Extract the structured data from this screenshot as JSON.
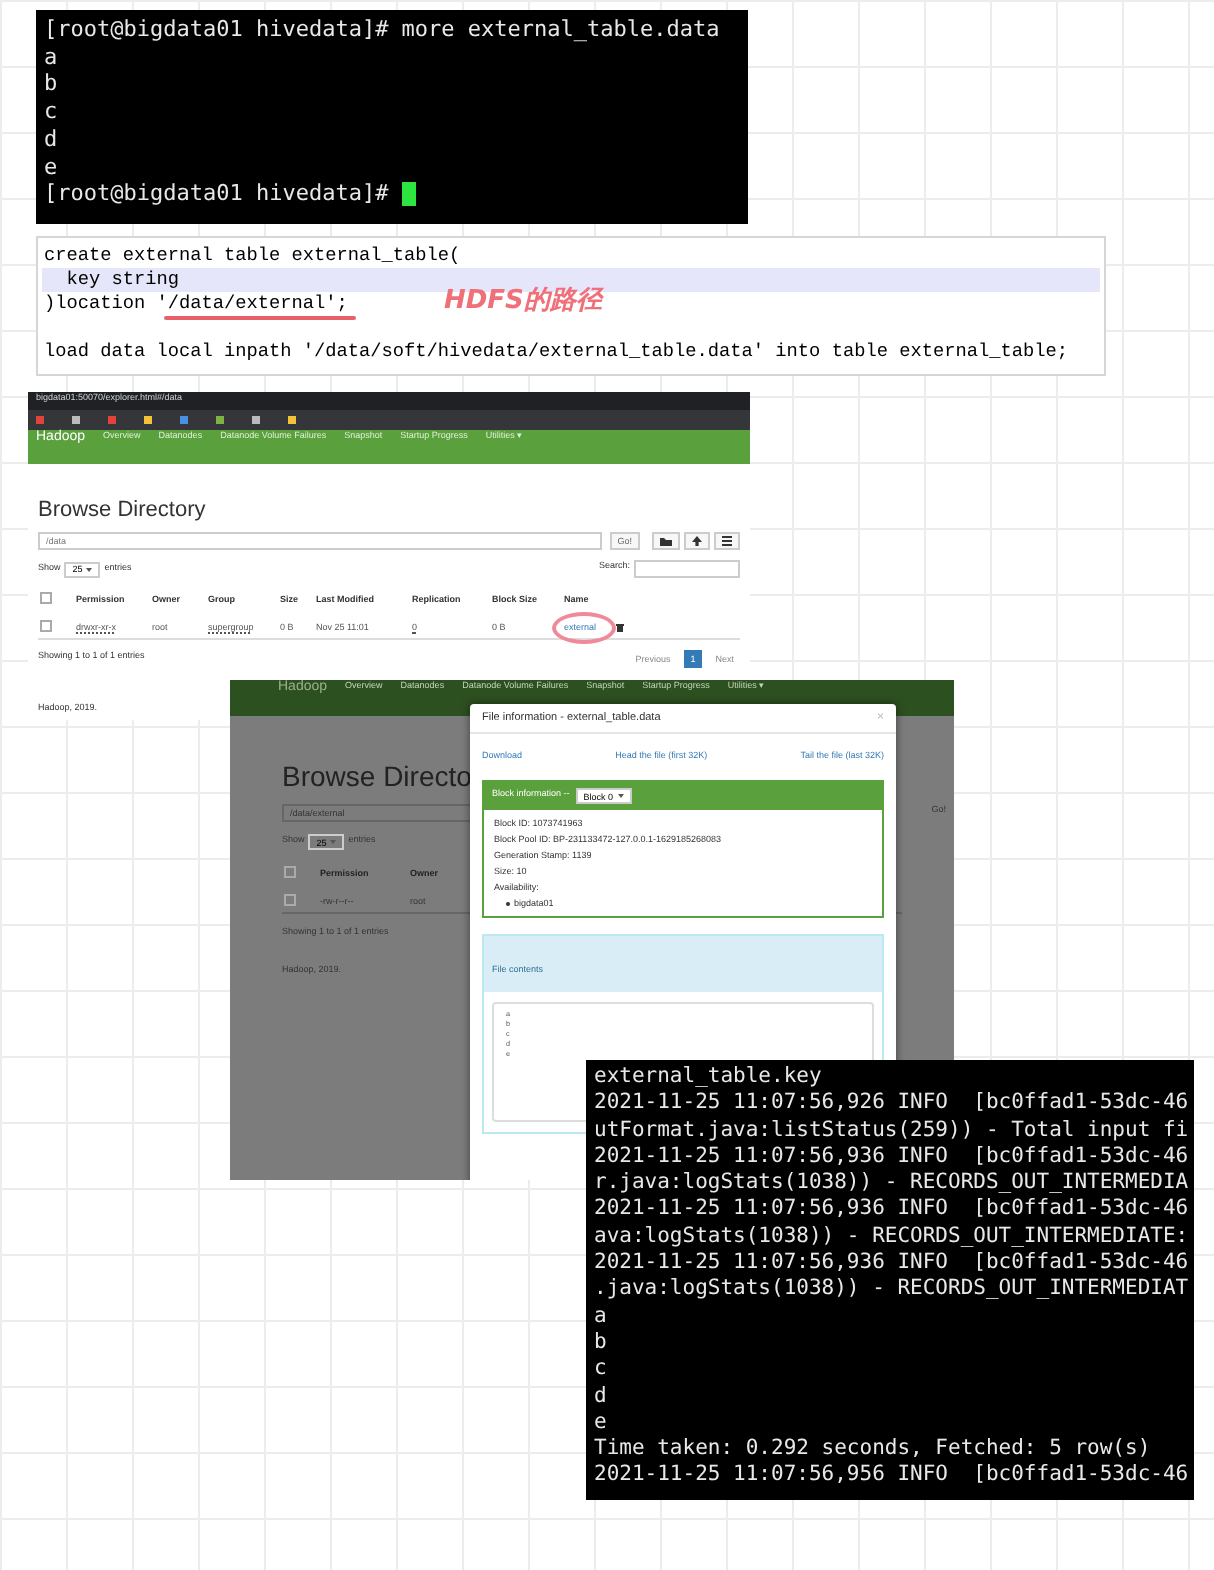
{
  "terminal_top": {
    "lines": [
      "[root@bigdata01 hivedata]# more external_table.data",
      "a",
      "b",
      "c",
      "d",
      "e",
      "[root@bigdata01 hivedata]# "
    ]
  },
  "code_snippet": {
    "lines": [
      {
        "text": "create external table external_table(",
        "highlighted": false
      },
      {
        "text": "  key string",
        "highlighted": true
      },
      {
        "text": ")location '/data/external';",
        "highlighted": false
      },
      {
        "highlighted": false
      },
      {
        "text": "load data local inpath '/data/soft/hivedata/external_table.data' into table external_table;",
        "highlighted": false
      }
    ],
    "annotation": "HDFS的路径"
  },
  "browser": {
    "url": "bigdata01:50070/explorer.html#/data",
    "brand": "Hadoop",
    "nav": [
      "Overview",
      "Datanodes",
      "Datanode Volume Failures",
      "Snapshot",
      "Startup Progress",
      "Utilities ▾"
    ],
    "heading": "Browse Directory",
    "path": "/data",
    "go": "Go!",
    "show_label": "Show",
    "page_size": "25",
    "entries_label": "entries",
    "search_label": "Search:",
    "header_checked": false,
    "columns": [
      "Permission",
      "Owner",
      "Group",
      "Size",
      "Last Modified",
      "Replication",
      "Block Size",
      "Name"
    ],
    "rows": [
      {
        "checked": false,
        "cells": [
          "drwxr-xr-x",
          "root",
          "supergroup",
          "0 B",
          "Nov 25 11:01",
          "0",
          "0 B",
          "external"
        ]
      }
    ],
    "info": "Showing 1 to 1 of 1 entries",
    "pages": [
      {
        "label": "Previous",
        "selected": false
      },
      {
        "label": "1",
        "selected": true
      },
      {
        "label": "Next",
        "selected": false
      }
    ],
    "copyright": "Hadoop, 2019."
  },
  "modal_screenshot": {
    "brand": "Hadoop",
    "nav": [
      "Overview",
      "Datanodes",
      "Datanode Volume Failures",
      "Snapshot",
      "Startup Progress",
      "Utilities ▾"
    ],
    "heading": "Browse Directo",
    "path": "/data/external",
    "go": "Go!",
    "show_label": "Show",
    "page_size": "25",
    "entries_label": "entries",
    "header_checked": false,
    "columns": [
      "Permission",
      "Owner"
    ],
    "row_checked": false,
    "row": [
      "-rw-r--r--",
      "root"
    ],
    "info": "Showing 1 to 1 of 1 entries",
    "copyright": "Hadoop, 2019.",
    "modal": {
      "title": "File information - external_table.data",
      "close": "×",
      "links": [
        "Download",
        "Head the file (first 32K)",
        "Tail the file (last 32K)"
      ],
      "block_label": "Block information --",
      "block_select": "Block 0",
      "details": [
        "Block ID: 1073741963",
        "Block Pool ID: BP-231133472-127.0.0.1-1629185268083",
        "Generation Stamp: 1139",
        "Size: 10",
        "Availability:"
      ],
      "hosts": [
        "bigdata01"
      ],
      "contents_label": "File contents",
      "contents": "a\nb\nc\nd\ne"
    }
  },
  "terminal_bottom": {
    "lines": [
      "external_table.key",
      "2021-11-25 11:07:56,926 INFO  [bc0ffad1-53dc-46",
      "utFormat.java:listStatus(259)) - Total input fi",
      "2021-11-25 11:07:56,936 INFO  [bc0ffad1-53dc-46",
      "r.java:logStats(1038)) - RECORDS_OUT_INTERMEDIA",
      "2021-11-25 11:07:56,936 INFO  [bc0ffad1-53dc-46",
      "ava:logStats(1038)) - RECORDS_OUT_INTERMEDIATE:",
      "2021-11-25 11:07:56,936 INFO  [bc0ffad1-53dc-46",
      ".java:logStats(1038)) - RECORDS_OUT_INTERMEDIAT",
      "a",
      "b",
      "c",
      "d",
      "e",
      "Time taken: 0.292 seconds, Fetched: 5 row(s)",
      "2021-11-25 11:07:56,956 INFO  [bc0ffad1-53dc-46"
    ]
  }
}
